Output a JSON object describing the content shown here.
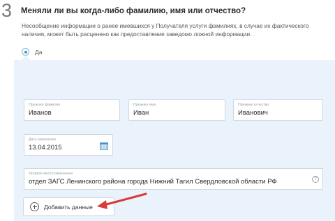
{
  "step": {
    "number": "3"
  },
  "question": {
    "title": "Меняли ли вы когда-либо фамилию, имя или отчество?",
    "description": "Несообщение информации о ранее имевшихся у Получателя услуги фамилиях, в случае их фактического наличия, может быть расценено как предоставление заведомо ложной информации."
  },
  "answer": {
    "selected_label": "Да"
  },
  "fields": {
    "surname": {
      "label": "Прежняя фамилия",
      "value": "Иванов"
    },
    "name": {
      "label": "Прежнее имя",
      "value": "Иван"
    },
    "patronymic": {
      "label": "Прежнее отчество",
      "value": "Иванович"
    },
    "date": {
      "label": "Дата изменения",
      "value": "13.04.2015"
    },
    "place": {
      "label": "Укажите место изменения",
      "value": "отдел ЗАГС Ленинского района города Нижний Тагил Свердловской области РФ"
    }
  },
  "add_button": {
    "label": "Добавить данные"
  },
  "icons": {
    "calendar": "calendar-icon",
    "help": "question-mark-icon",
    "add": "plus-circle-icon",
    "annotation": "red-arrow"
  },
  "colors": {
    "panel_background": "#eaf3fb",
    "radio_accent": "#4b8fc4",
    "arrow": "#d93a3a"
  }
}
